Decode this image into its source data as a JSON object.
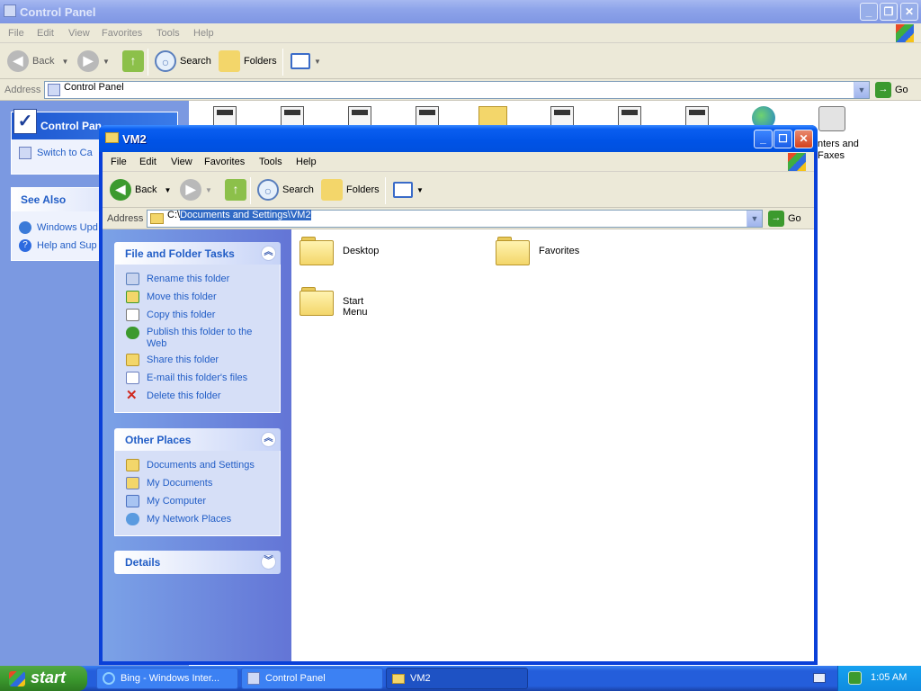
{
  "bg_window": {
    "title": "Control Panel",
    "menu": [
      "File",
      "Edit",
      "View",
      "Favorites",
      "Tools",
      "Help"
    ],
    "toolbar": {
      "back": "Back",
      "search": "Search",
      "folders": "Folders"
    },
    "address_label": "Address",
    "address_value": "Control Panel",
    "go_label": "Go",
    "left_box_title": "Control Pan",
    "switch_view": "Switch to Ca",
    "see_also_title": "See Also",
    "see_also_items": [
      "Windows Upd",
      "Help and Sup"
    ],
    "printer_label_1": "nters and",
    "printer_label_2": "Faxes"
  },
  "explorer": {
    "title": "VM2",
    "menu": [
      "File",
      "Edit",
      "View",
      "Favorites",
      "Tools",
      "Help"
    ],
    "toolbar": {
      "back": "Back",
      "search": "Search",
      "folders": "Folders"
    },
    "address_label": "Address",
    "address_prefix": "C:\\",
    "address_selected": "Documents and Settings\\VM2",
    "go_label": "Go",
    "file_tasks": {
      "title": "File and Folder Tasks",
      "items": [
        "Rename this folder",
        "Move this folder",
        "Copy this folder",
        "Publish this folder to the Web",
        "Share this folder",
        "E-mail this folder's files",
        "Delete this folder"
      ]
    },
    "other_places": {
      "title": "Other Places",
      "items": [
        "Documents and Settings",
        "My Documents",
        "My Computer",
        "My Network Places"
      ]
    },
    "details": {
      "title": "Details"
    },
    "folders": [
      "Desktop",
      "Favorites",
      "Start Menu"
    ]
  },
  "taskbar": {
    "start": "start",
    "tasks": [
      "Bing - Windows Inter...",
      "Control Panel",
      "VM2"
    ],
    "clock": "1:05 AM"
  },
  "colors": {
    "xp_blue": "#0053e6",
    "task_link": "#215dc6",
    "start_green": "#3c9a2e"
  }
}
